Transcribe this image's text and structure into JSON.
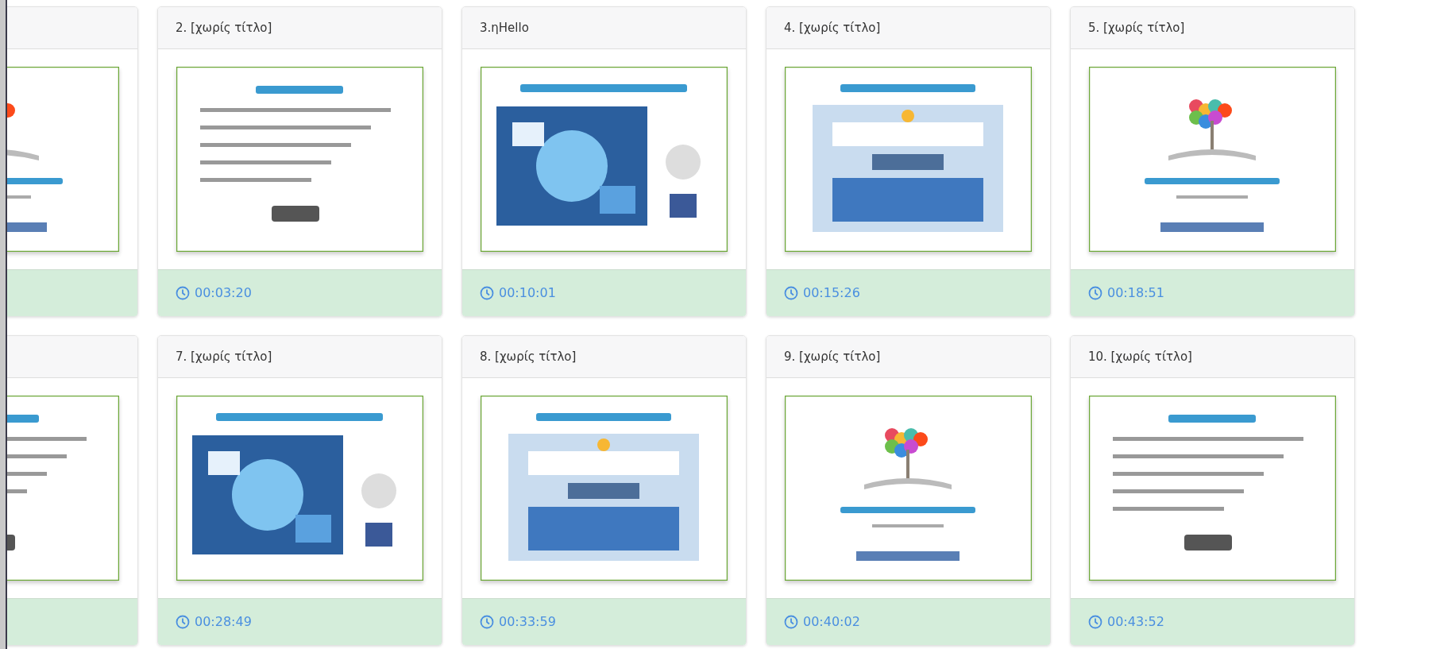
{
  "cards": [
    {
      "thumbnail": {
        "kind": "picture"
      }
    },
    {
      "title": "2. [χωρίς τίτλο]",
      "time": "00:03:20",
      "thumbnail": {
        "kind": "picture"
      }
    },
    {
      "title": "3.ηHello",
      "time": "00:10:01",
      "thumbnail": {
        "kind": "picture"
      }
    },
    {
      "title": "4. [χωρίς τίτλο]",
      "time": "00:15:26",
      "thumbnail": {
        "kind": "picture"
      }
    },
    {
      "title": "5. [χωρίς τίτλο]",
      "time": "00:18:51",
      "thumbnail": {
        "kind": "picture"
      }
    },
    {
      "thumbnail": {
        "kind": "picture"
      }
    },
    {
      "title": "7. [χωρίς τίτλο]",
      "time": "00:28:49",
      "thumbnail": {
        "kind": "picture"
      }
    },
    {
      "title": "8. [χωρίς τίτλο]",
      "time": "00:33:59",
      "thumbnail": {
        "kind": "picture"
      }
    },
    {
      "title": "9. [χωρίς τίτλο]",
      "time": "00:40:02",
      "thumbnail": {
        "kind": "picture"
      }
    },
    {
      "title": "10. [χωρίς τίτλο]",
      "time": "00:43:52",
      "thumbnail": {
        "kind": "picture"
      }
    }
  ]
}
